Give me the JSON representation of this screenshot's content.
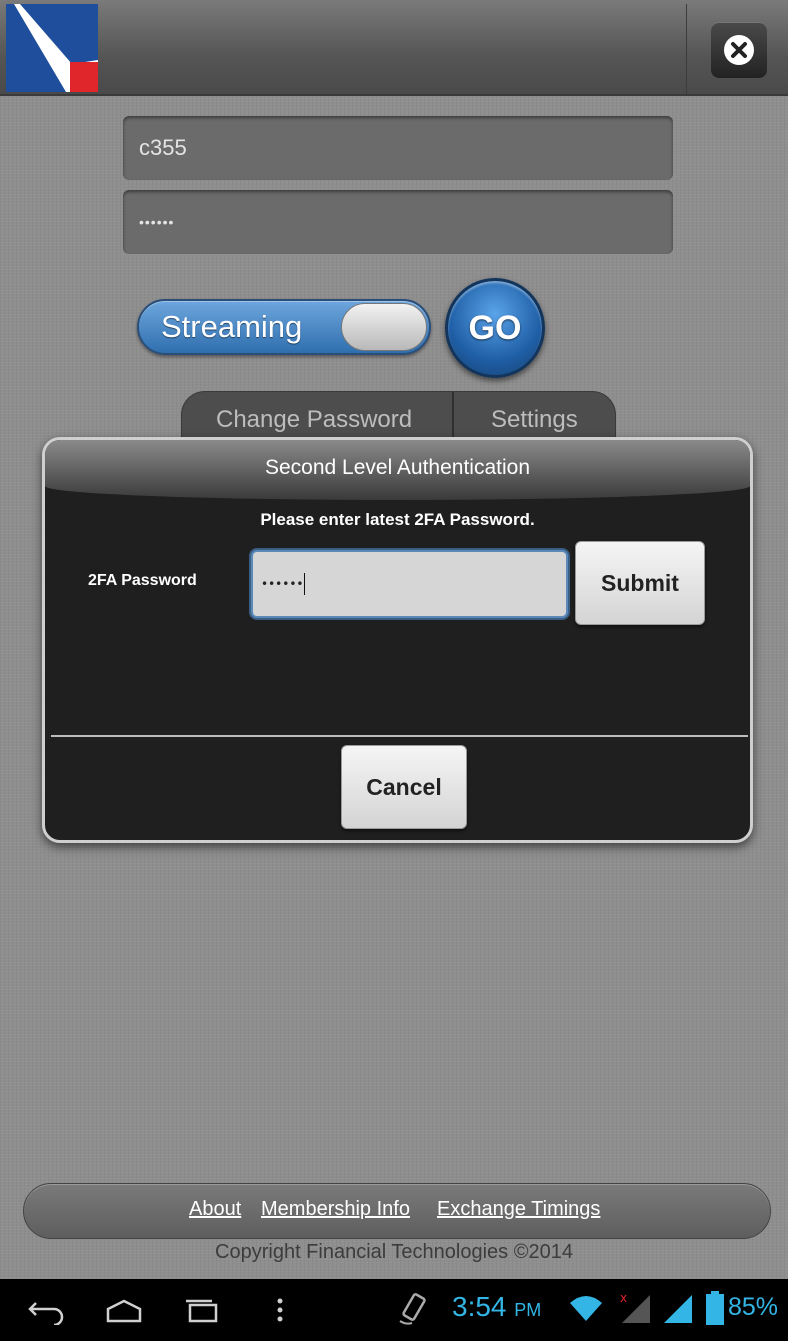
{
  "login": {
    "username_value": "c355",
    "password_value": "••••••"
  },
  "mode_toggle": {
    "label": "Streaming",
    "state": "on"
  },
  "go_button": {
    "label": "GO"
  },
  "tabs": [
    {
      "label": "Change Password"
    },
    {
      "label": "Settings"
    }
  ],
  "dialog": {
    "title": "Second Level Authentication",
    "message": "Please enter latest 2FA Password.",
    "field_label": "2FA Password",
    "field_value": "••••••",
    "submit_label": "Submit",
    "cancel_label": "Cancel"
  },
  "footer": {
    "links": [
      {
        "label": "About"
      },
      {
        "label": "Membership Info"
      },
      {
        "label": "Exchange Timings"
      }
    ],
    "copyright": "Copyright Financial Technologies ©2014"
  },
  "status_bar": {
    "time": "3:54",
    "ampm": "PM",
    "battery": "85%",
    "accent_color": "#33b5e5",
    "icons": [
      "back-icon",
      "home-icon",
      "recent-apps-icon",
      "menu-icon",
      "rotation-lock-icon",
      "wifi-icon",
      "signal-icon",
      "battery-icon"
    ]
  }
}
